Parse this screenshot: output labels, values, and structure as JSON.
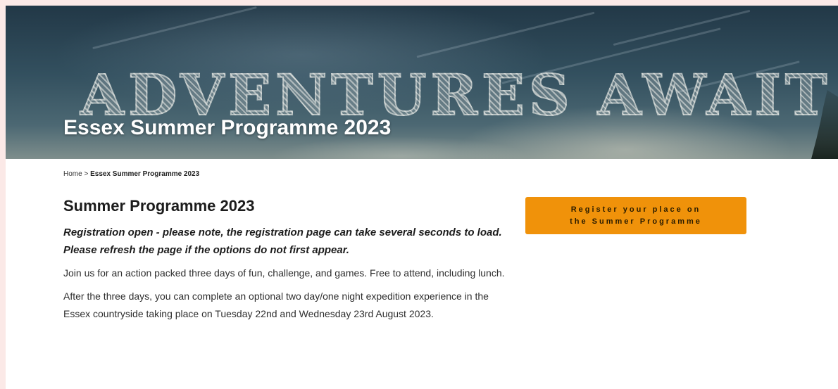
{
  "hero": {
    "tagline": "ADVENTURES AWAIT",
    "title": "Essex Summer Programme 2023"
  },
  "breadcrumb": {
    "home": "Home",
    "separator": ">",
    "current": "Essex Summer Programme 2023"
  },
  "main": {
    "heading": "Summer Programme 2023",
    "notice": "Registration open - please note, the registration page can take several seconds to load. Please refresh the page if the options do not first appear.",
    "paragraph_1": "Join us for an action packed three days of fun, challenge, and games. Free to attend, including lunch.",
    "paragraph_2": "After the three days, you can complete an optional two day/one night expedition experience in the Essex countryside taking place on Tuesday 22nd and Wednesday 23rd August 2023."
  },
  "sidebar": {
    "register_line_1": "Register your place on",
    "register_line_2": "the Summer Programme"
  },
  "colors": {
    "accent": "#f0920a",
    "page_border": "#fbe9e7",
    "hero_sky": "#2f4a59"
  }
}
